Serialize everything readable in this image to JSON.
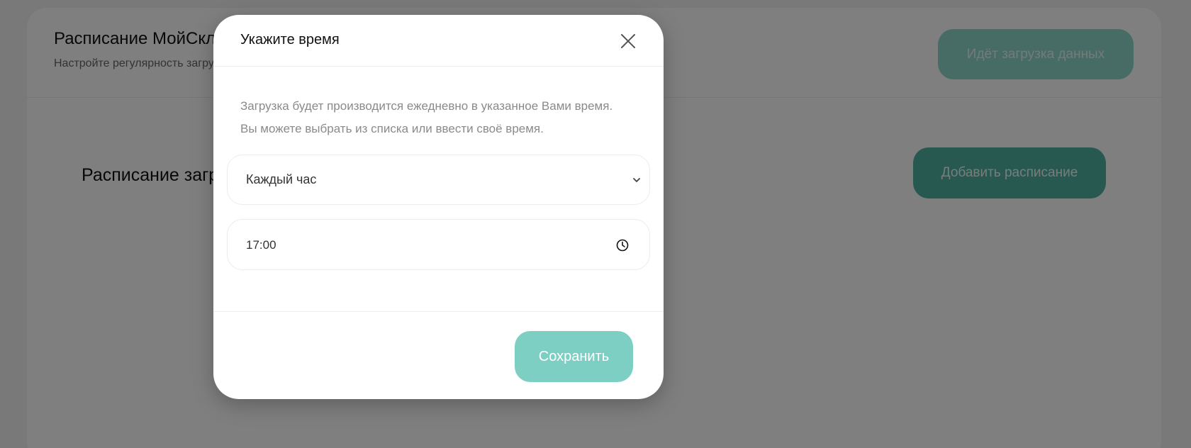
{
  "page": {
    "title": "Расписание МойСклад",
    "subtitle": "Настройте регулярность загрузки данных",
    "loading_button_label": "Идёт загрузка данных",
    "schedule_heading": "Расписание загрузки",
    "add_schedule_label": "Добавить расписание"
  },
  "modal": {
    "title": "Укажите время",
    "close_icon": "close-icon",
    "description": "Загрузка будет производится ежедневно в указанное Вами время. Вы можете выбрать из списка или ввести своё время.",
    "select": {
      "value": "Каждый час",
      "icon": "chevron-down-icon"
    },
    "time": {
      "value": "17:00",
      "icon": "clock-icon"
    },
    "save_label": "Сохранить"
  },
  "colors": {
    "accent": "#7dcfc3",
    "accent_dark": "#4fb3a3",
    "overlay": "rgba(0,0,0,0.5)"
  }
}
